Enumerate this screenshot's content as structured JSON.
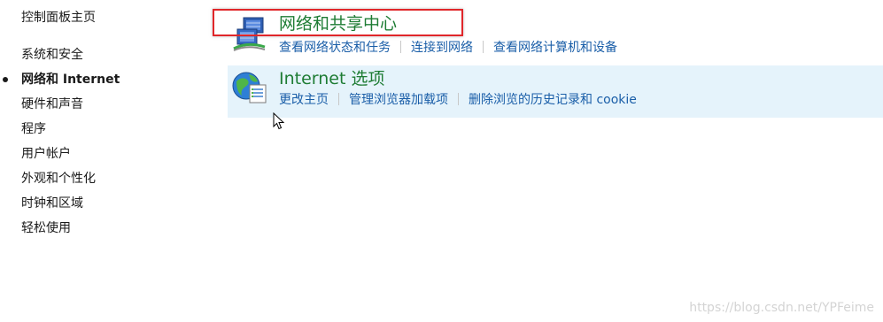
{
  "sidebar": {
    "home": "控制面板主页",
    "items": [
      {
        "label": "系统和安全",
        "active": false
      },
      {
        "label": "网络和 Internet",
        "active": true
      },
      {
        "label": "硬件和声音",
        "active": false
      },
      {
        "label": "程序",
        "active": false
      },
      {
        "label": "用户帐户",
        "active": false
      },
      {
        "label": "外观和个性化",
        "active": false
      },
      {
        "label": "时钟和区域",
        "active": false
      },
      {
        "label": "轻松使用",
        "active": false
      }
    ]
  },
  "categories": [
    {
      "title": "网络和共享中心",
      "icon": "network-sharing-icon",
      "links": [
        "查看网络状态和任务",
        "连接到网络",
        "查看网络计算机和设备"
      ]
    },
    {
      "title": "Internet 选项",
      "icon": "internet-options-icon",
      "links": [
        "更改主页",
        "管理浏览器加载项",
        "删除浏览的历史记录和 cookie"
      ]
    }
  ],
  "colors": {
    "title_green": "#1e7c34",
    "link_blue": "#1a5ea8",
    "hover_bg": "#e5f3fb",
    "highlight_red": "#e0262a"
  },
  "watermark": "https://blog.csdn.net/YPFeime"
}
